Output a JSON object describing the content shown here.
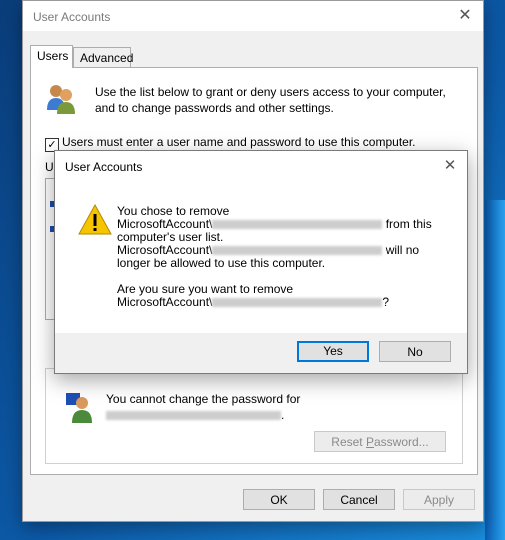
{
  "window": {
    "title": "User Accounts",
    "close_glyph": "✕",
    "tabs": [
      {
        "label": "Users"
      },
      {
        "label": "Advanced"
      }
    ],
    "intro_text": "Use the list below to grant or deny users access to your computer, and to change passwords and other settings.",
    "require_password": {
      "label": "Users must enter a user name and password to use this computer.",
      "checked": true,
      "check_glyph": "✓"
    },
    "users_label": "Us",
    "password_group": {
      "text": "You cannot change the password for",
      "trailing_period": ".",
      "reset_button": {
        "label_pre": "Reset ",
        "label_key": "P",
        "label_post": "assword..."
      }
    },
    "buttons": {
      "ok": "OK",
      "cancel": "Cancel",
      "apply": "Apply"
    }
  },
  "dialog": {
    "title": "User Accounts",
    "close_glyph": "✕",
    "icon": "warning-icon",
    "line1": "You chose to remove",
    "prefix": "MicrosoftAccount\\",
    "line2_tail": "from this",
    "line3": "computer's user list.",
    "line4_tail": "will no",
    "line5": "longer be allowed to use this computer.",
    "question": "Are you sure you want to remove",
    "question_tail": "?",
    "buttons": {
      "yes": "Yes",
      "no": "No"
    }
  },
  "colors": {
    "accent": "#0078d7",
    "warning": "#f7c400"
  }
}
